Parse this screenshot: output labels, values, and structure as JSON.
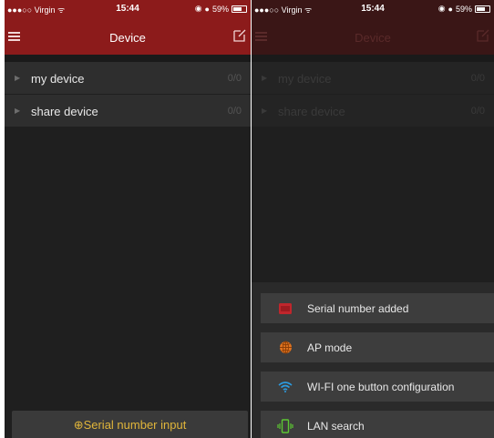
{
  "status": {
    "carrier": "●●●○○ Virgin",
    "time": "15:44",
    "battery": "59%"
  },
  "header": {
    "title": "Device"
  },
  "devices": [
    {
      "label": "my device",
      "count": "0/0"
    },
    {
      "label": "share device",
      "count": "0/0"
    }
  ],
  "bottom_button": {
    "label": "⊕Serial number input"
  },
  "sheet": {
    "items": [
      {
        "label": "Serial number added",
        "icon": "barcode-icon",
        "color": "#c0262c"
      },
      {
        "label": "AP mode",
        "icon": "globe-icon",
        "color": "#e0731f"
      },
      {
        "label": "WI-FI one button configuration",
        "icon": "wifi-icon",
        "color": "#2c9be0"
      },
      {
        "label": "LAN search",
        "icon": "phone-lan-icon",
        "color": "#5cc733"
      }
    ]
  },
  "colors": {
    "appbar": "#8c1b1b",
    "accent": "#e0b53a"
  }
}
